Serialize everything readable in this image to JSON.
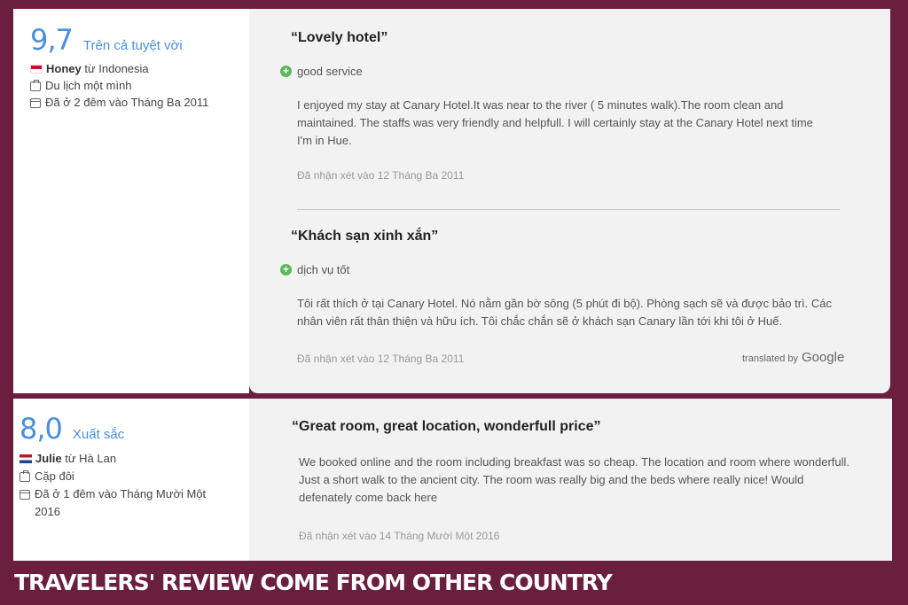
{
  "reviews": [
    {
      "score": "9,7",
      "score_label": "Trên cả tuyệt vời",
      "reviewer_name": "Honey",
      "reviewer_origin": " từ Indonesia",
      "trip_type": "Du lịch một mình",
      "stay": "Đã ở 2 đêm vào Tháng Ba 2011",
      "original": {
        "title": "“Lovely hotel”",
        "positive": "good service",
        "text": "I enjoyed my stay at Canary Hotel.It was near to the river ( 5 minutes walk).The room clean and maintained. The staffs was very friendly and helpfull. I will certainly stay at the Canary Hotel next time I'm in Hue.",
        "date": "Đã nhận xét vào 12 Tháng Ba 2011"
      },
      "translation": {
        "title": "“Khách sạn xinh xắn”",
        "positive": "dịch vụ tốt",
        "text": "Tôi rất thích ở tại Canary Hotel. Nó nằm gần bờ sông (5 phút đi bộ). Phòng sạch sẽ và được bảo trì. Các nhân viên rất thân thiện và hữu ích. Tôi chắc chắn sẽ ở khách sạn Canary lần tới khi tôi ở Huế.",
        "date": "Đã nhận xét vào 12 Tháng Ba 2011",
        "translated_by": "translated by",
        "translated_brand": "Google"
      }
    },
    {
      "score": "8,0",
      "score_label": "Xuất sắc",
      "reviewer_name": "Julie",
      "reviewer_origin": " từ Hà Lan",
      "trip_type": "Cặp đôi",
      "stay": "Đã ở 1 đêm vào Tháng Mười Một 2016",
      "original": {
        "title": "“Great room, great location, wonderfull price”",
        "text": "We booked online and the room including breakfast was so cheap. The location and room where wonderfull. Just a short walk to the ancient city. The room was really big and the beds where really nice! Would defenately come back here",
        "date": "Đã nhận xét vào 14 Tháng Mười Một 2016"
      }
    }
  ],
  "icons": [
    "flag-indonesia-icon",
    "suitcase-icon",
    "calendar-icon",
    "plus-icon",
    "flag-netherlands-icon"
  ],
  "colors": {
    "background": "#6b1f3e",
    "score": "#4a8fdb",
    "positive": "#5cb85c"
  },
  "banner": "TRAVELERS' REVIEW COME FROM OTHER COUNTRY"
}
